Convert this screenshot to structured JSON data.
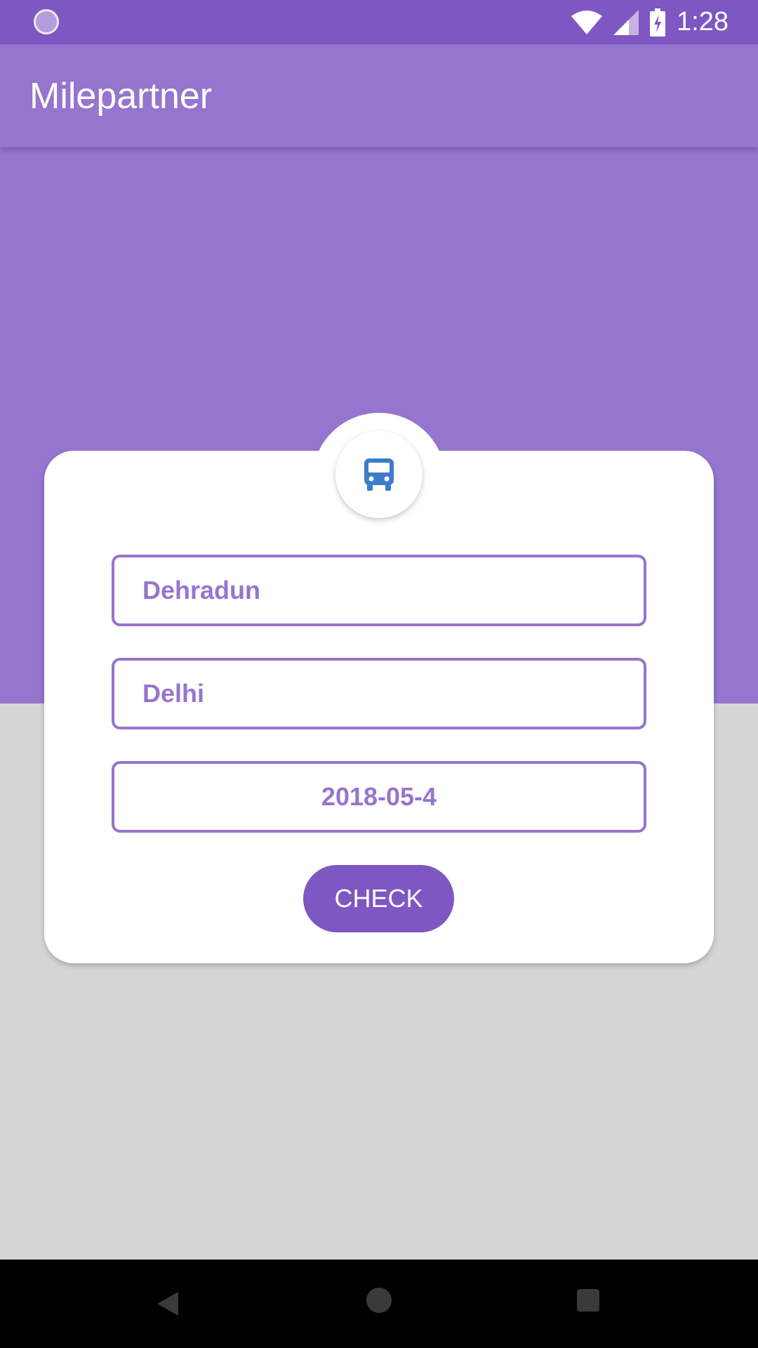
{
  "status_bar": {
    "time": "1:28",
    "icons": [
      "loading-icon",
      "wifi-icon",
      "signal-icon",
      "battery-charging-icon"
    ]
  },
  "app_bar": {
    "title": "Milepartner"
  },
  "form": {
    "bus_icon": "bus-icon",
    "from_value": "Dehradun",
    "to_value": "Delhi",
    "date_value": "2018-05-4",
    "check_label": "CHECK"
  },
  "nav_bar": {
    "icons": [
      "back-icon",
      "home-icon",
      "recents-icon"
    ]
  },
  "colors": {
    "primary": "#9575cd",
    "primary_dark": "#7e57c2",
    "background_lower": "#d6d6d6",
    "bus_icon_blue": "#3d7cc9"
  }
}
